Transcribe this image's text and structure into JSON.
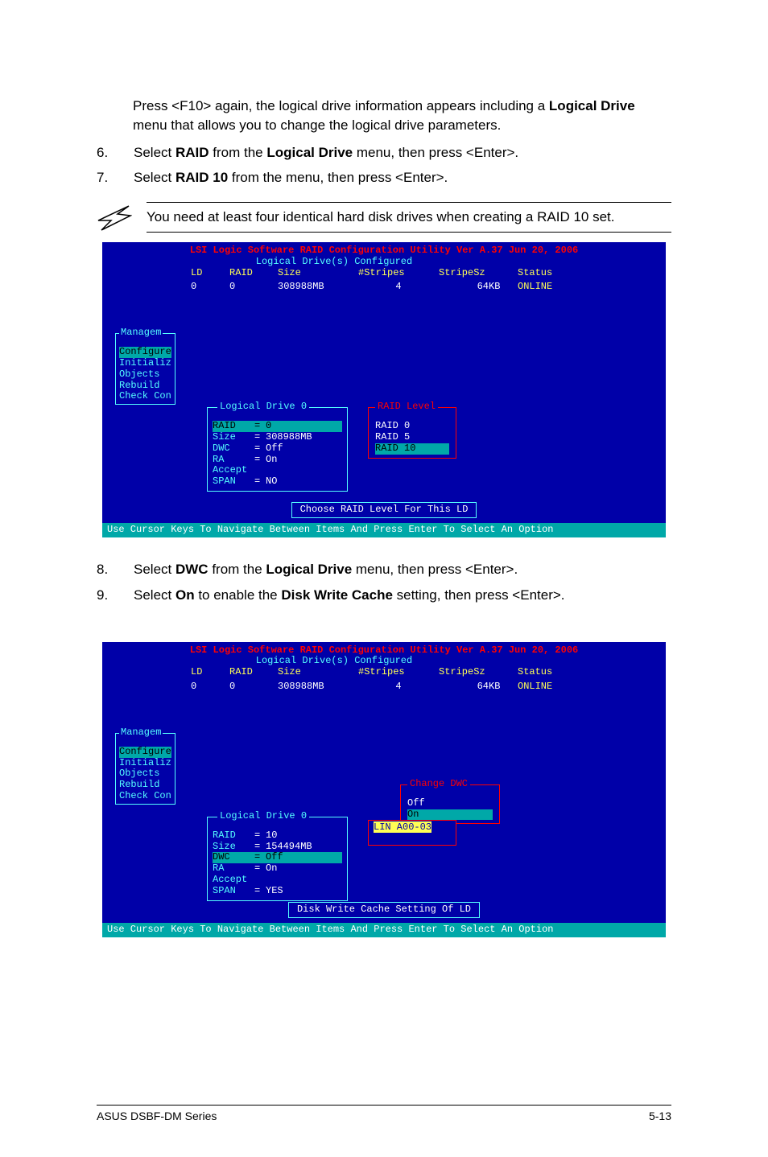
{
  "intro": {
    "p1a": "Press <F10> again, the logical drive information appears including a ",
    "p1b": "Logical Drive",
    "p1c": " menu that allows you to change the logical drive parameters."
  },
  "steps": {
    "s6": {
      "num": "6.",
      "a": "Select ",
      "b": "RAID",
      "c": " from the ",
      "d": "Logical Drive",
      "e": " menu, then press <Enter>."
    },
    "s7": {
      "num": "7.",
      "a": "Select ",
      "b": "RAID 10",
      "c": " from the menu, then press <Enter>."
    },
    "s8": {
      "num": "8.",
      "a": "Select ",
      "b": "DWC",
      "c": " from the ",
      "d": "Logical Drive",
      "e": " menu, then press <Enter>."
    },
    "s9": {
      "num": "9.",
      "a": "Select ",
      "b": "On",
      "c": " to enable the ",
      "d": "Disk Write Cache",
      "e": " setting, then press <Enter>."
    }
  },
  "note": "You need at least four identical hard disk drives when creating a RAID 10 set.",
  "term": {
    "title": "LSI Logic Software RAID Configuration Utility Ver A.37 Jun 20, 2006",
    "subhead": "Logical Drive(s) Configured",
    "cols": {
      "ld": "LD",
      "raid": "RAID",
      "size": "Size",
      "stripes": "#Stripes",
      "stripesz": "StripeSz",
      "status": "Status"
    },
    "row": {
      "ld": "0",
      "raid": "0",
      "size": "308988MB",
      "stripes": "4",
      "szval": "64",
      "szunit": "KB",
      "status": "ONLINE"
    },
    "menu_label": "Managem",
    "menu": [
      "Configure",
      "Initializ",
      "Objects",
      "Rebuild",
      "Check Con"
    ],
    "ldbox_label": "Logical Drive 0",
    "ld0": {
      "raid_k": "RAID",
      "raid_v": "0",
      "size_k": "Size",
      "size_v": "308988MB",
      "dwc_k": "DWC",
      "dwc_v": "Off",
      "ra_k": "RA",
      "ra_v": "On",
      "accept": "Accept",
      "span_k": "SPAN",
      "span_v": "NO"
    },
    "raid_popup_label": "RAID Level",
    "raid_opts": [
      "RAID 0",
      "RAID 5",
      "RAID 10"
    ],
    "prompt1": "Choose RAID Level For This LD",
    "footer_bar": "Use Cursor Keys To Navigate Between Items And Press Enter To Select An Option"
  },
  "term2": {
    "row": {
      "ld": "0",
      "raid": "0",
      "size": "308988MB",
      "stripes": "4",
      "szval": "64",
      "szunit": "KB",
      "status": "ONLINE"
    },
    "ld0": {
      "raid_k": "RAID",
      "raid_v": "10",
      "size_k": "Size",
      "size_v": "154494MB",
      "dwc_k": "DWC",
      "dwc_v": "Off",
      "ra_k": "RA",
      "ra_v": "On",
      "accept": "Accept",
      "span_k": "SPAN",
      "span_v": "YES"
    },
    "dwc_label": "Change DWC",
    "dwc_opts": [
      "Off",
      "On"
    ],
    "lin": "LIN A00-03",
    "prompt": "Disk Write Cache Setting Of LD"
  },
  "footer": {
    "left": "ASUS DSBF-DM Series",
    "right": "5-13"
  }
}
